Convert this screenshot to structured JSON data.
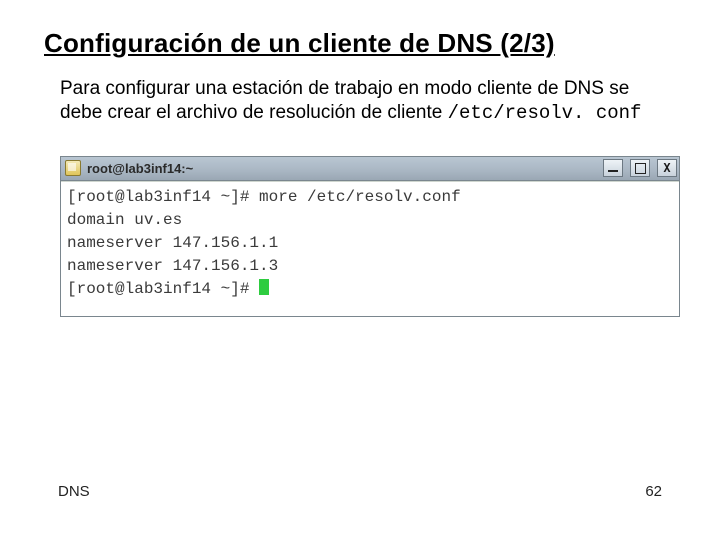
{
  "title": "Configuración de un cliente de DNS (2/3)",
  "body": {
    "pre": "Para configurar una estación de trabajo en modo cliente de DNS se debe crear el archivo de resolución de cliente ",
    "path": "/etc/resolv. conf"
  },
  "terminal": {
    "window_title": "root@lab3inf14:~",
    "lines": [
      "[root@lab3inf14 ~]# more /etc/resolv.conf",
      "domain uv.es",
      "nameserver 147.156.1.1",
      "nameserver 147.156.1.3"
    ],
    "prompt": "[root@lab3inf14 ~]# ",
    "close_glyph": "X"
  },
  "footer": {
    "left": "DNS",
    "right": "62"
  }
}
